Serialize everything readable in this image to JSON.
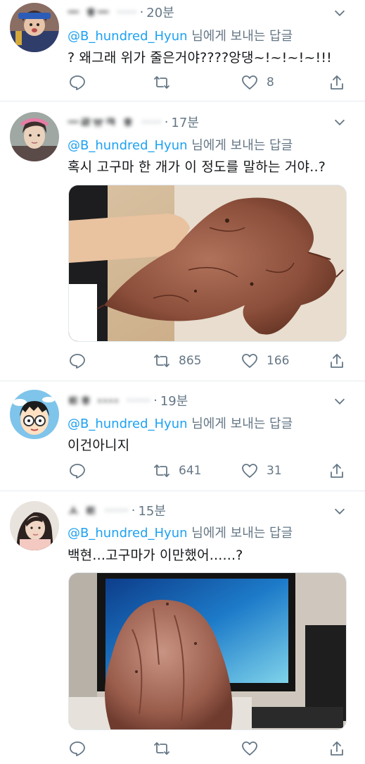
{
  "reply_prefix": "@B_hundred_Hyun",
  "reply_suffix": " 님에게 보내는 답글",
  "tweets": [
    {
      "name": "ㅡ ㅎㅡ",
      "handle": "·····",
      "time": "20분",
      "text": "? 왜그래 위가 줄은거야????앙댕~!~!~!~!!!",
      "replies": "",
      "retweets": "",
      "likes": "8"
    },
    {
      "name": "ㅡㄹㅠㅋ ㅎ",
      "handle": "·····",
      "time": "17분",
      "text": "혹시 고구마 한 개가 이 정도를 말하는 거야..?",
      "replies": "",
      "retweets": "865",
      "likes": "166"
    },
    {
      "name": "ㅌㅎ ····",
      "handle": "······",
      "time": "19분",
      "text": "이건아니지",
      "replies": "",
      "retweets": "641",
      "likes": "31"
    },
    {
      "name": "ㅅ ㅌ",
      "handle": "······",
      "time": "15분",
      "text": "백현...고구마가 이만했어......?",
      "replies": "",
      "retweets": "",
      "likes": ""
    }
  ],
  "icons": {
    "reply": "reply-icon",
    "retweet": "retweet-icon",
    "like": "heart-icon",
    "share": "share-icon",
    "more": "chevron-down-icon"
  },
  "colors": {
    "mention": "#1da1f2",
    "secondary_text": "#657786",
    "divider": "#e6ecf0"
  }
}
